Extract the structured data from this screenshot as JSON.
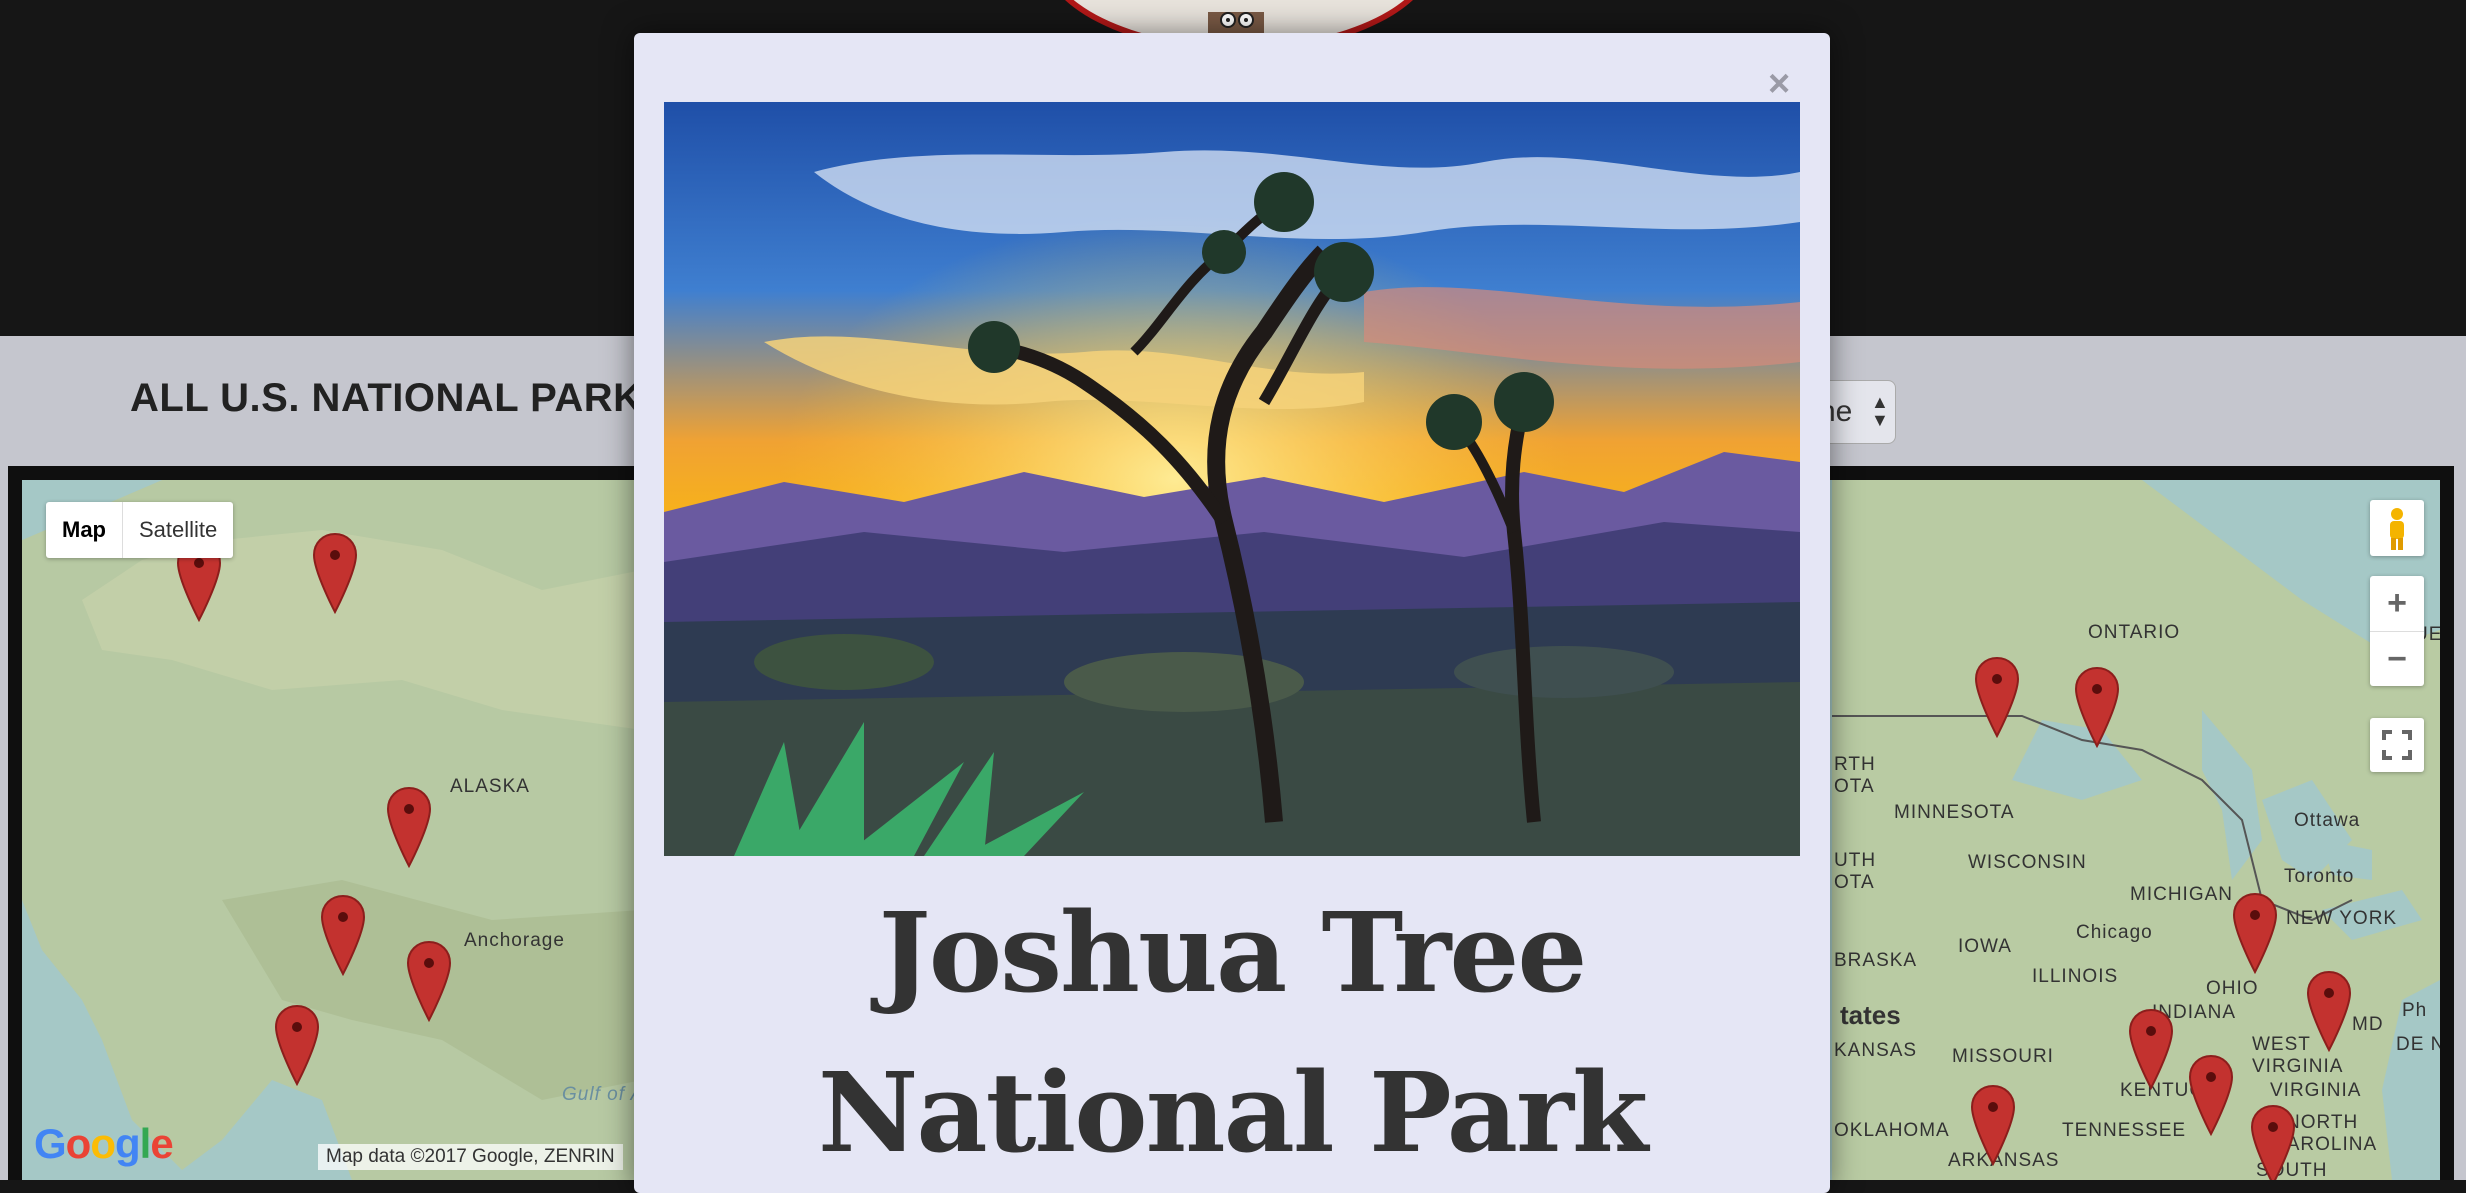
{
  "section": {
    "title": "ALL U.S. NATIONAL PARKS",
    "filter_value": "ne"
  },
  "map": {
    "type_control": {
      "map_label": "Map",
      "satellite_label": "Satellite"
    },
    "zoom": {
      "in_label": "+",
      "out_label": "−"
    },
    "attribution": "Map data ©2017 Google, ZENRIN",
    "google_logo": "Google",
    "labels": {
      "alaska": "ALASKA",
      "anchorage": "Anchorage",
      "gulf": "Gulf of A",
      "ontario": "ONTARIO",
      "rth_dakota": "RTH",
      "ota": "OTA",
      "minnesota": "MINNESOTA",
      "wisconsin": "WISCONSIN",
      "ottawa": "Ottawa",
      "toronto": "Toronto",
      "uth_dakota": "UTH",
      "ota2": "OTA",
      "michigan": "MICHIGAN",
      "new_york": "NEW YORK",
      "chicago": "Chicago",
      "iowa": "IOWA",
      "ohio": "OHIO",
      "braska": "BRASKA",
      "illinois": "ILLINOIS",
      "indiana": "INDIANA",
      "states": "tates",
      "kansas": "KANSAS",
      "missouri": "MISSOURI",
      "west_virginia": "WEST",
      "virginia_w": "VIRGINIA",
      "md": "MD",
      "de_nj": "DE NJ",
      "ph": "Ph",
      "kentucky": "KENTUCKY",
      "virginia": "VIRGINIA",
      "oklahoma": "OKLAHOMA",
      "tennessee": "TENNESSEE",
      "north": "NORTH",
      "carolina": "CAROLINA",
      "arkansas": "ARKANSAS",
      "south": "SOUTH",
      "ue": "UE"
    }
  },
  "modal": {
    "close_label": "×",
    "title": "Joshua Tree National Park"
  },
  "colors": {
    "pin": "#c3322f",
    "modal_bg": "#e5e6f5",
    "logo_ring": "#b21818"
  },
  "icons": [
    "close-icon",
    "map-pin-icon",
    "pegman-icon",
    "fullscreen-icon",
    "sort-arrows-icon"
  ]
}
